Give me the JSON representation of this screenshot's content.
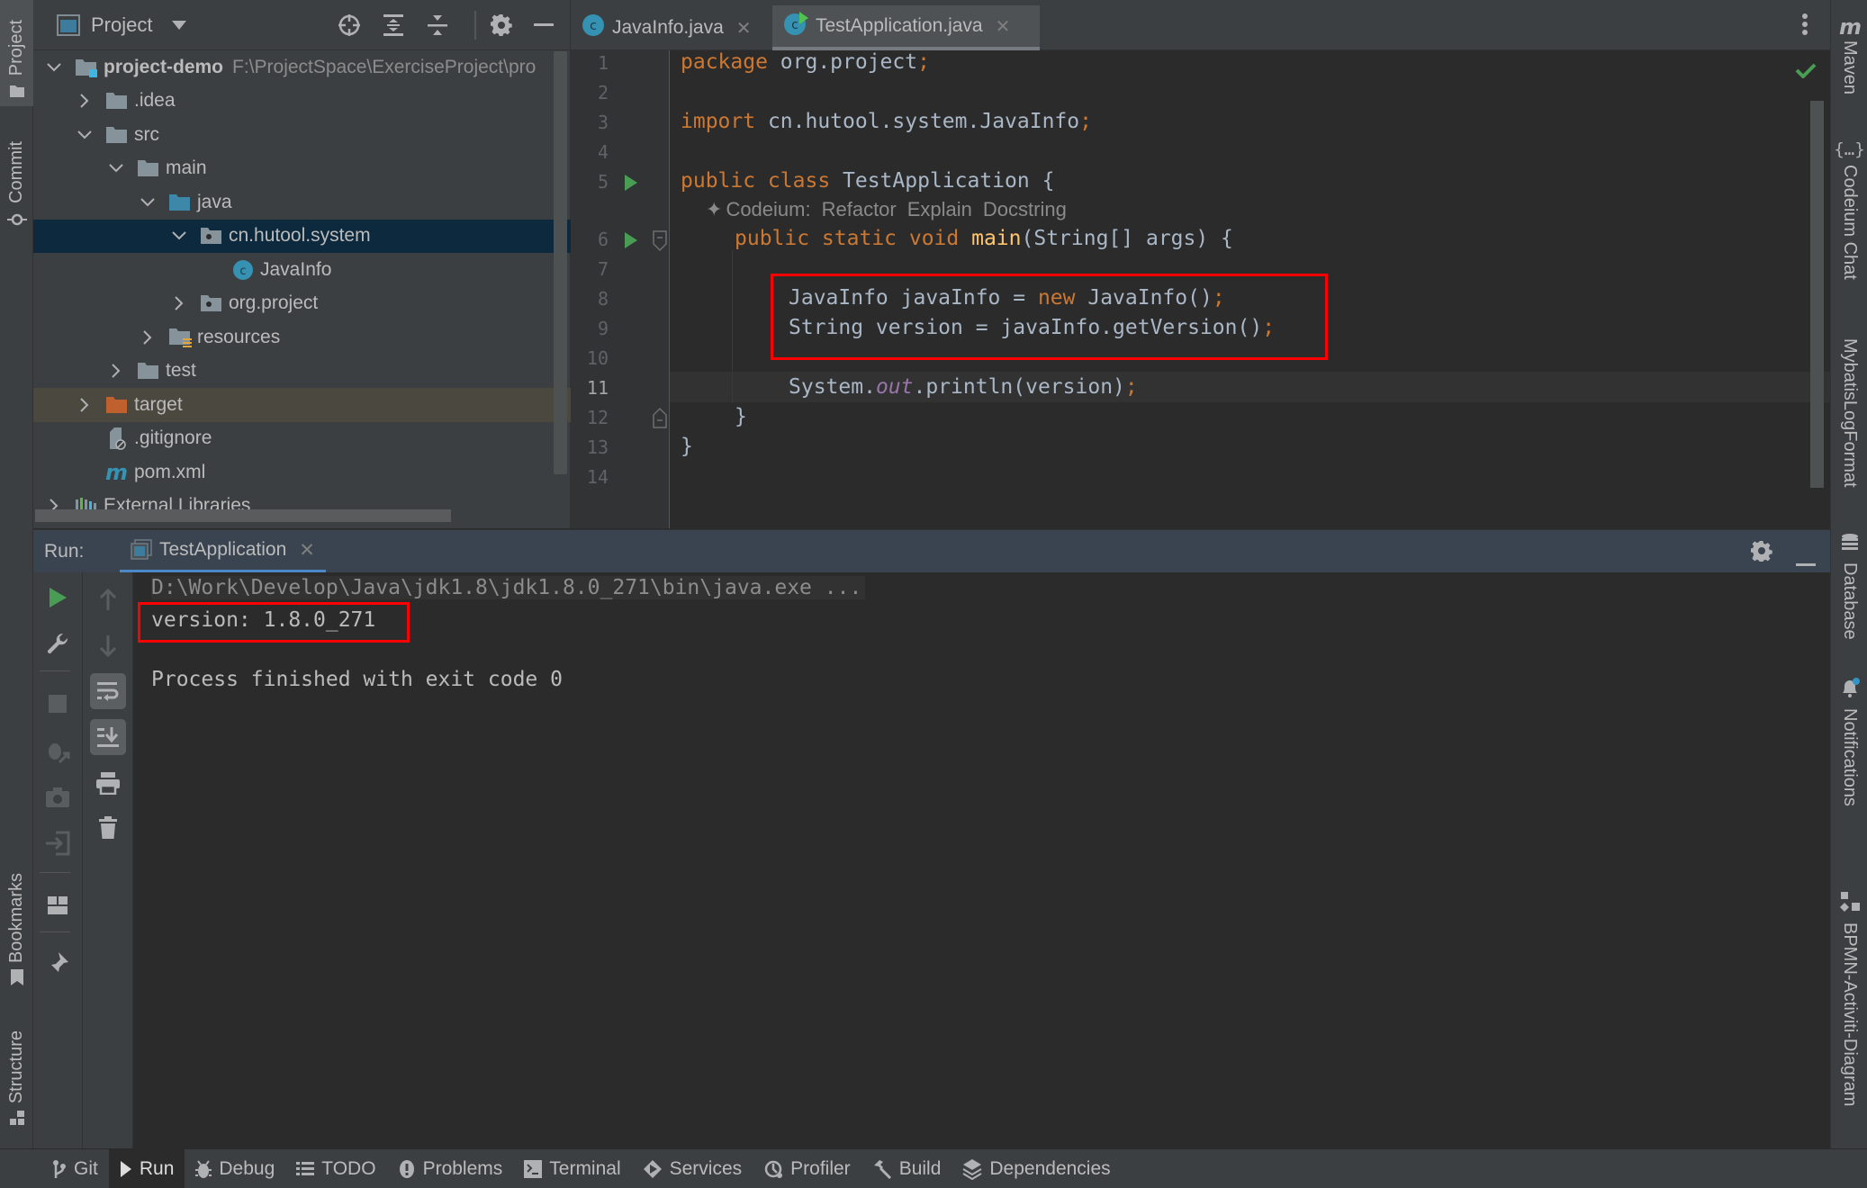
{
  "left_strip": {
    "tabs": [
      {
        "label": "Project",
        "icon": "folder-icon",
        "active": true
      },
      {
        "label": "Commit",
        "icon": "commit-icon"
      },
      {
        "label": "Bookmarks",
        "icon": "bookmark-icon"
      },
      {
        "label": "Structure",
        "icon": "structure-icon"
      }
    ]
  },
  "right_strip": {
    "tabs": [
      {
        "label": "Maven",
        "icon": "maven-icon"
      },
      {
        "label": "Codeium Chat",
        "icon": "braces-icon"
      },
      {
        "label": "MybatisLogFormat",
        "icon": ""
      },
      {
        "label": "Database",
        "icon": "database-icon"
      },
      {
        "label": "Notifications",
        "icon": "bell-icon"
      },
      {
        "label": "BPMN-Activiti-Diagram",
        "icon": "diagram-icon"
      }
    ]
  },
  "project_panel": {
    "title": "Project",
    "tree": [
      {
        "label": "project-demo",
        "path": "F:\\ProjectSpace\\ExerciseProject\\pro",
        "type": "module",
        "depth": 0,
        "expanded": true
      },
      {
        "label": ".idea",
        "type": "folder",
        "depth": 1,
        "expanded": false
      },
      {
        "label": "src",
        "type": "folder",
        "depth": 1,
        "expanded": true
      },
      {
        "label": "main",
        "type": "folder",
        "depth": 2,
        "expanded": true
      },
      {
        "label": "java",
        "type": "source-folder",
        "depth": 3,
        "expanded": true
      },
      {
        "label": "cn.hutool.system",
        "type": "package",
        "depth": 4,
        "expanded": true,
        "selected": true
      },
      {
        "label": "JavaInfo",
        "type": "class",
        "depth": 5
      },
      {
        "label": "org.project",
        "type": "package",
        "depth": 4,
        "expanded": false
      },
      {
        "label": "resources",
        "type": "resources-folder",
        "depth": 3,
        "expanded": false
      },
      {
        "label": "test",
        "type": "folder",
        "depth": 2,
        "expanded": false
      },
      {
        "label": "target",
        "type": "excluded-folder",
        "depth": 1,
        "expanded": false
      },
      {
        "label": ".gitignore",
        "type": "ignore-file",
        "depth": 1
      },
      {
        "label": "pom.xml",
        "type": "maven-file",
        "depth": 1
      },
      {
        "label": "External Libraries",
        "type": "libraries",
        "depth": 0,
        "expanded": false
      }
    ]
  },
  "editor": {
    "tabs": [
      {
        "label": "JavaInfo.java",
        "active": false
      },
      {
        "label": "TestApplication.java",
        "active": true
      }
    ],
    "current_line": 11,
    "line_numbers": [
      "1",
      "2",
      "3",
      "4",
      "5",
      "6",
      "7",
      "8",
      "9",
      "10",
      "11",
      "12",
      "13",
      "14"
    ],
    "codeium_hint": {
      "prefix": "Codeium:",
      "actions": [
        "Refactor",
        "Explain",
        "Docstring"
      ]
    },
    "code": {
      "l1_kw": "package",
      "l1_rest": " org.project",
      "semi": ";",
      "l3_kw": "import",
      "l3_rest": " cn.hutool.system.JavaInfo",
      "l5_kw": "public class",
      "l5_rest": " TestApplication {",
      "l6_kw": "public static void",
      "l6_fn": "main",
      "l6_rest": "(String[] args) {",
      "l8_a": "JavaInfo javaInfo = ",
      "l8_kw": "new",
      "l8_b": " JavaInfo()",
      "l9": "String version = javaInfo.getVersion()",
      "l11_a": "System.",
      "l11_static": "out",
      "l11_b": ".println(version)",
      "l12": "}",
      "l13": "}"
    }
  },
  "run_panel": {
    "label": "Run:",
    "tab": "TestApplication",
    "console": {
      "command": "D:\\Work\\Develop\\Java\\jdk1.8\\jdk1.8.0_271\\bin\\java.exe ...",
      "output": "version: 1.8.0_271",
      "finished": "Process finished with exit code 0"
    }
  },
  "bottom_bar": {
    "items": [
      {
        "label": "Git",
        "icon": "git-branch-icon"
      },
      {
        "label": "Run",
        "icon": "run-icon",
        "active": true
      },
      {
        "label": "Debug",
        "icon": "bug-icon"
      },
      {
        "label": "TODO",
        "icon": "list-icon"
      },
      {
        "label": "Problems",
        "icon": "problems-icon"
      },
      {
        "label": "Terminal",
        "icon": "terminal-icon"
      },
      {
        "label": "Services",
        "icon": "services-icon"
      },
      {
        "label": "Profiler",
        "icon": "profiler-icon"
      },
      {
        "label": "Build",
        "icon": "hammer-icon"
      },
      {
        "label": "Dependencies",
        "icon": "dependencies-icon"
      }
    ]
  },
  "colors": {
    "keyword": "#cc7832",
    "function": "#ffc66d",
    "static_field": "#9876aa",
    "text": "#a9b7c6",
    "highlight_box": "#ff0000",
    "run_green": "#499c54",
    "selection": "#0d293e"
  }
}
